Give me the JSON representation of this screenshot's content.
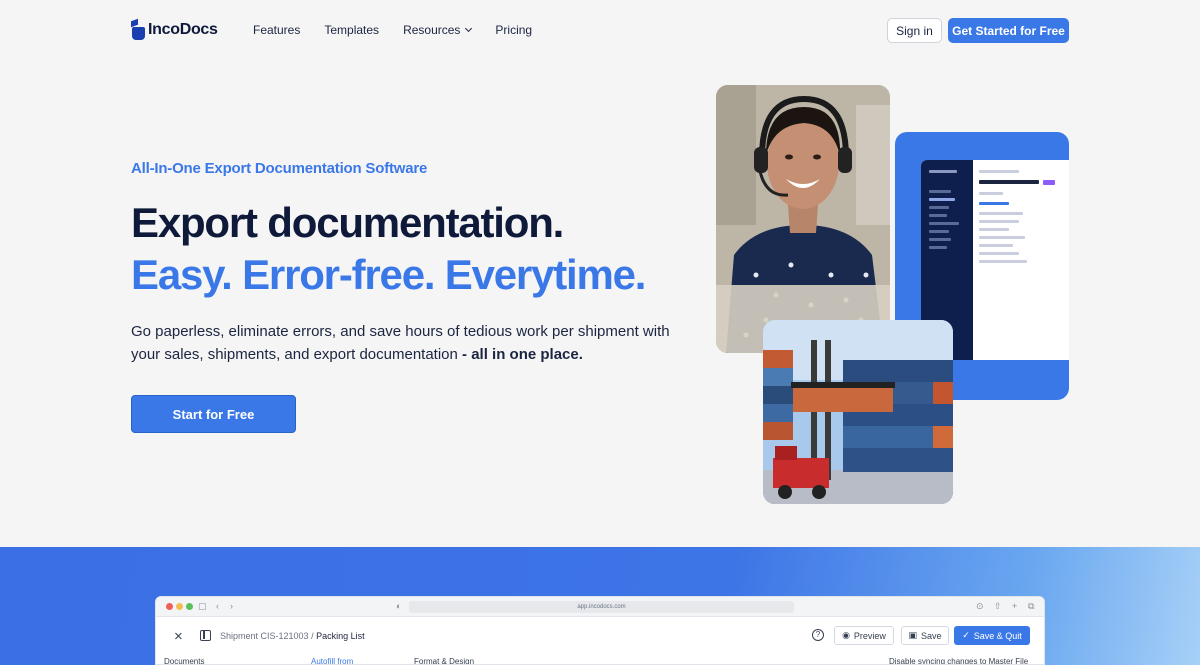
{
  "nav": {
    "logo_text": "IncoDocs",
    "links": [
      "Features",
      "Templates",
      "Resources",
      "Pricing"
    ],
    "sign_in": "Sign in",
    "get_started": "Get Started for Free"
  },
  "hero": {
    "eyebrow": "All-In-One Export Documentation Software",
    "headline_1": "Export documentation.",
    "headline_2": "Easy. Error-free. Everytime.",
    "lead": "Go paperless, eliminate errors, and save hours of tedious work per shipment with your sales, shipments, and export documentation",
    "lead_strong": " - all in one place.",
    "cta": "Start for Free"
  },
  "app_window": {
    "url": "app.incodocs.com",
    "breadcrumb_parent": "Shipment CIS-121003",
    "breadcrumb_separator": " / ",
    "breadcrumb_current": "Packing List",
    "preview": "Preview",
    "save": "Save",
    "save_quit": "Save & Quit",
    "documents": "Documents",
    "autofill": "Autofill from",
    "format": "Format & Design",
    "sync": "Disable syncing changes to Master File"
  },
  "colors": {
    "brand": "#3b78e7",
    "navy": "#0f1a3a"
  }
}
